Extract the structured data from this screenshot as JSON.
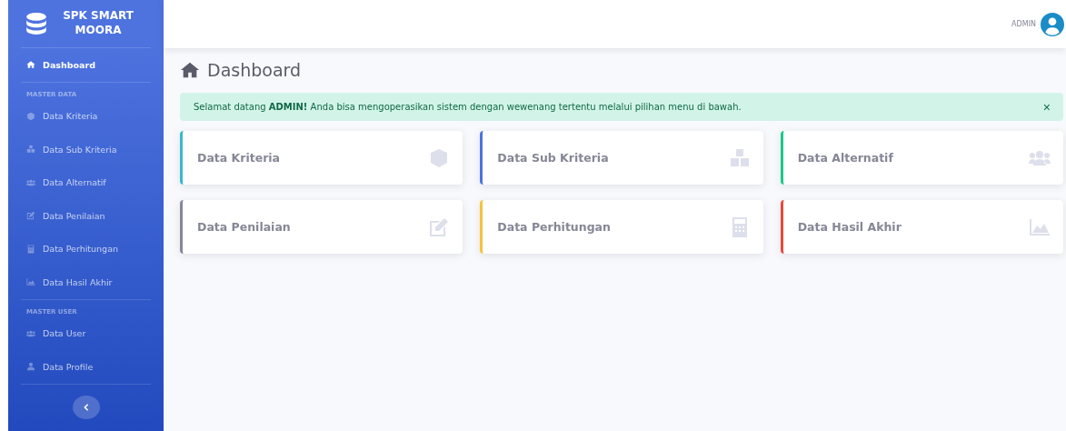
{
  "brand": {
    "name": "SPK SMART MOORA"
  },
  "sidebar": {
    "items": [
      {
        "kind": "link",
        "label": "Dashboard",
        "selected": true
      },
      {
        "kind": "heading",
        "label": "MASTER DATA"
      },
      {
        "kind": "link",
        "label": "Data Kriteria",
        "selected": false
      },
      {
        "kind": "link",
        "label": "Data Sub Kriteria",
        "selected": false
      },
      {
        "kind": "link",
        "label": "Data Alternatif",
        "selected": false
      },
      {
        "kind": "link",
        "label": "Data Penilaian",
        "selected": false
      },
      {
        "kind": "link",
        "label": "Data Perhitungan",
        "selected": false
      },
      {
        "kind": "link",
        "label": "Data Hasil Akhir",
        "selected": false
      },
      {
        "kind": "heading",
        "label": "MASTER USER"
      },
      {
        "kind": "link",
        "label": "Data User",
        "selected": false
      },
      {
        "kind": "link",
        "label": "Data Profile",
        "selected": false
      }
    ]
  },
  "topbar": {
    "user": "ADMIN"
  },
  "page_title": "Dashboard",
  "alert": {
    "text": "Selamat datang **ADMIN!** Anda bisa mengoperasikan sistem dengan wewenang tertentu melalui pilihan menu di bawah.",
    "close": "×"
  },
  "cards": [
    {
      "label": "Data Kriteria",
      "color": "#36b9cc"
    },
    {
      "label": "Data Sub Kriteria",
      "color": "#4e73df"
    },
    {
      "label": "Data Alternatif",
      "color": "#1cc88a"
    },
    {
      "label": "Data Penilaian",
      "color": "#858796"
    },
    {
      "label": "Data Perhitungan",
      "color": "#f6c23e"
    },
    {
      "label": "Data Hasil Akhir",
      "color": "#e74a3b"
    }
  ]
}
